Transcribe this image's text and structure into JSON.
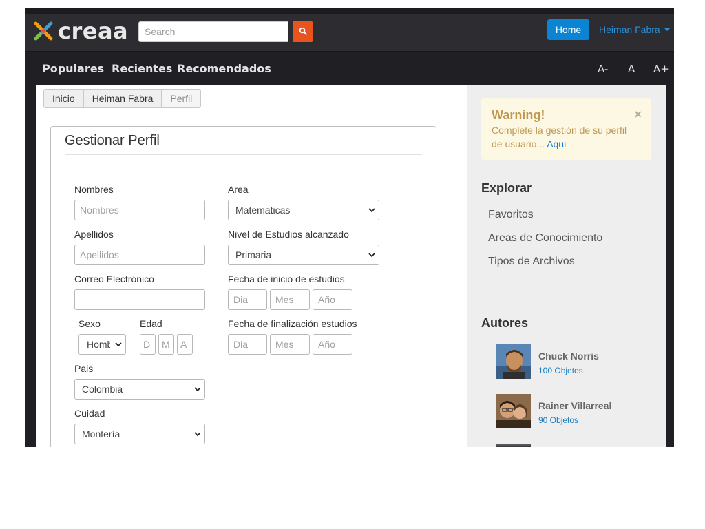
{
  "brand": {
    "name": "creaa"
  },
  "search": {
    "placeholder": "Search"
  },
  "header": {
    "home_label": "Home",
    "user_name": "Heiman Fabra"
  },
  "subnav": {
    "items": [
      "Populares",
      "Recientes",
      "Recomendados"
    ],
    "font_controls": [
      "A-",
      "A",
      "A+"
    ]
  },
  "breadcrumb": [
    "Inicio",
    "Heiman Fabra",
    "Perfil"
  ],
  "form": {
    "title": "Gestionar Perfil",
    "nombres": {
      "label": "Nombres",
      "placeholder": "Nombres",
      "value": ""
    },
    "apellidos": {
      "label": "Apellidos",
      "placeholder": "Apellidos",
      "value": ""
    },
    "correo": {
      "label": "Correo Electrónico",
      "value": ""
    },
    "sexo": {
      "label": "Sexo",
      "value": "Homb"
    },
    "edad": {
      "label": "Edad",
      "placeholders": [
        "D",
        "M",
        "A"
      ]
    },
    "pais": {
      "label": "Pais",
      "value": "Colombia"
    },
    "ciudad": {
      "label": "Cuidad",
      "value": "Montería"
    },
    "area": {
      "label": "Area",
      "value": "Matematicas"
    },
    "nivel": {
      "label": "Nivel de Estudios alcanzado",
      "value": "Primaria"
    },
    "fecha_inicio": {
      "label": "Fecha de inicio de estudios",
      "placeholders": [
        "Dia",
        "Mes",
        "Año"
      ]
    },
    "fecha_fin": {
      "label": "Fecha de finalización estudios",
      "placeholders": [
        "Dia",
        "Mes",
        "Año"
      ]
    }
  },
  "sidebar": {
    "warning": {
      "title": "Warning!",
      "text": "Complete la gestión de su perfil de usuario...",
      "link": "Aqui",
      "close": "×"
    },
    "explorar": {
      "title": "Explorar",
      "links": [
        "Favoritos",
        "Areas de Conocimiento",
        "Tipos de Archivos"
      ]
    },
    "autores": {
      "title": "Autores",
      "items": [
        {
          "name": "Chuck Norris",
          "count": "100 Objetos"
        },
        {
          "name": "Rainer Villarreal",
          "count": "90 Objetos"
        }
      ]
    }
  },
  "colors": {
    "accent_orange": "#e8531f",
    "primary_blue": "#0a84d3",
    "navbar_dark": "#2c2c31",
    "warning_bg": "#fcf8e3",
    "warning_text": "#c09853"
  }
}
